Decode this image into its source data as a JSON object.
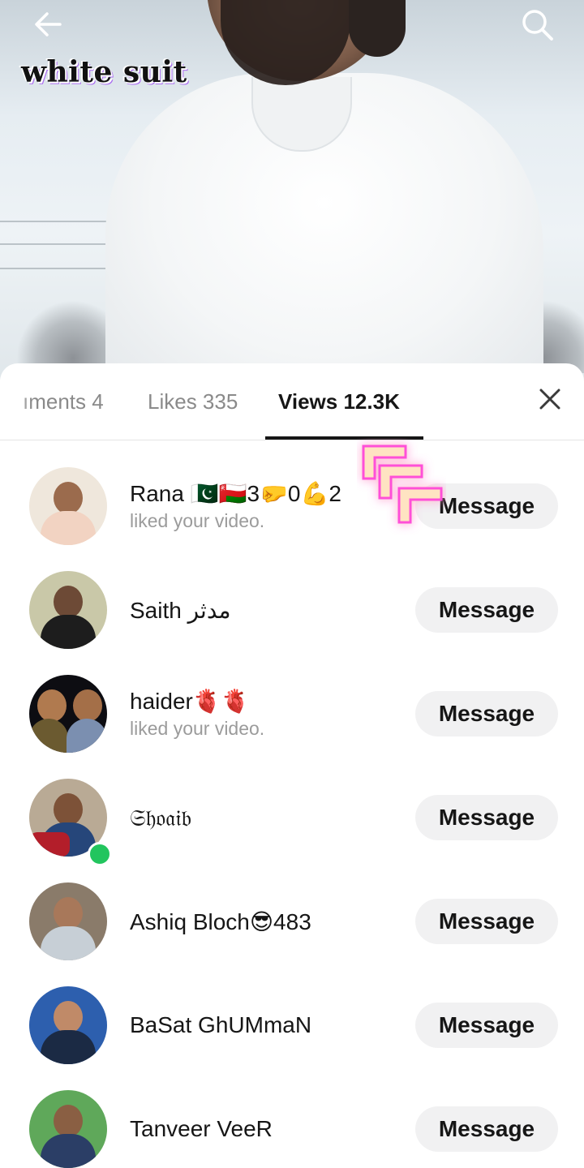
{
  "preview": {
    "caption": "white suit",
    "back_icon": "arrow-left-icon",
    "search_icon": "search-icon"
  },
  "tabs": [
    {
      "label": "ıments 4",
      "active": false
    },
    {
      "label": "Likes 335",
      "active": false
    },
    {
      "label": "Views 12.3K",
      "active": true
    }
  ],
  "close_icon": "close-icon",
  "viewers": [
    {
      "name": "Rana 🇵🇰🇴🇲3🤛0💪2",
      "subtitle": "liked your video.",
      "button": "Message",
      "online": false
    },
    {
      "name": "Saith مدثر",
      "subtitle": "",
      "button": "Message",
      "online": false
    },
    {
      "name": "haider🫀🫀",
      "subtitle": "liked your video.",
      "button": "Message",
      "online": false
    },
    {
      "name": "𝔖𝔥𝔬𝔞𝔦𝔟",
      "subtitle": "",
      "button": "Message",
      "online": true
    },
    {
      "name": "Ashiq Bloch😎483",
      "subtitle": "",
      "button": "Message",
      "online": false
    },
    {
      "name": "BaSat GhUMmaN",
      "subtitle": "",
      "button": "Message",
      "online": false
    },
    {
      "name": "Tanveer VeeR",
      "subtitle": "",
      "button": "Message",
      "online": false
    }
  ],
  "colors": {
    "online": "#22c55e",
    "button_bg": "#f1f1f2",
    "sparkle": "#ff4fd8"
  }
}
